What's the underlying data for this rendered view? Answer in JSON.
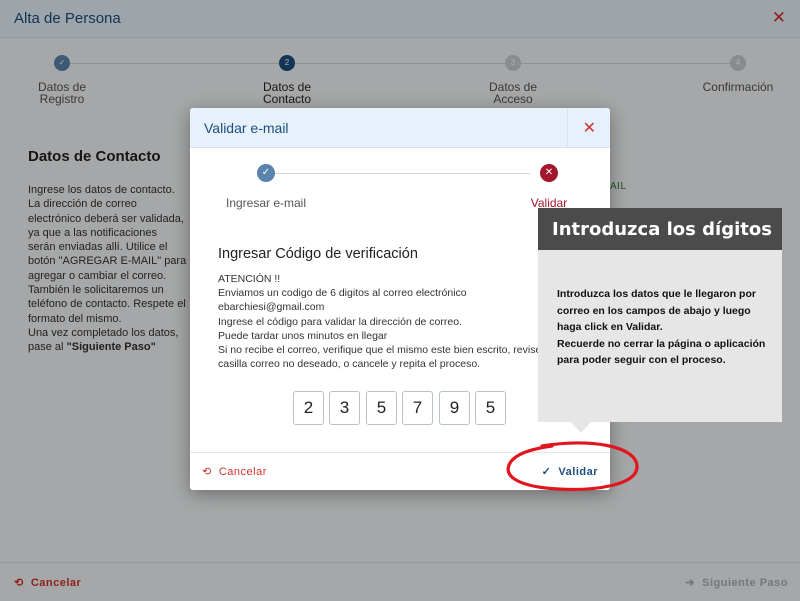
{
  "window": {
    "title": "Alta de Persona",
    "close_icon": "✕"
  },
  "stepper": {
    "steps": [
      {
        "number": "",
        "label_line1": "Datos de",
        "label_line2": "Registro",
        "state": "done"
      },
      {
        "number": "2",
        "label_line1": "Datos de",
        "label_line2": "Contacto",
        "state": "active"
      },
      {
        "number": "3",
        "label_line1": "Datos de",
        "label_line2": "Acceso",
        "state": "pending"
      },
      {
        "number": "4",
        "label_line1": "Confirmación",
        "label_line2": "",
        "state": "pending"
      }
    ]
  },
  "contact": {
    "heading": "Datos de Contacto",
    "instructions": [
      "Ingrese los datos de contacto.",
      "La dirección de correo",
      "electrónico deberá ser validada,",
      "ya que a las notificaciones",
      "serán enviadas allí. Utilice el",
      "botón \"AGREGAR E-MAIL\" para",
      "agregar o cambiar el correo.",
      "También le solicitaremos un",
      "teléfono de contacto. Respete el",
      "formato del mismo.",
      "Una vez completado los datos,"
    ],
    "instructions_last_prefix": "pase al ",
    "instructions_last_bold": "\"Siguiente Paso\"",
    "email_hint": "AIL"
  },
  "footer": {
    "cancel_label": "Cancelar",
    "next_label": "Siguiente Paso"
  },
  "modal": {
    "title": "Validar e-mail",
    "steps": [
      {
        "label": "Ingresar e-mail",
        "state": "done"
      },
      {
        "label": "Validar",
        "state": "error"
      }
    ],
    "code_title": "Ingresar Código de verificación",
    "message_lines": [
      "ATENCIÓN !!",
      "Enviamos un codigo de 6 digitos al correo electrónico",
      "ebarchiesi@gmail.com",
      "Ingrese el código para validar la dirección de correo.",
      "Puede tardar unos minutos en llegar",
      "Si no recibe el correo, verifique que el mismo este bien escrito, revise la",
      "casilla correo no deseado, o cancele y repita el proceso."
    ],
    "digits": [
      "2",
      "3",
      "5",
      "7",
      "9",
      "5"
    ],
    "cancel_label": "Cancelar",
    "validate_label": "Validar"
  },
  "tooltip": {
    "heading": "Introduzca  los dígitos",
    "lines": [
      "Introduzca los datos que le llegaron por",
      "correo en los campos de abajo y luego",
      "haga click en Validar.",
      "Recuerde no cerrar la página o aplicación",
      "para poder seguir con el proceso."
    ]
  },
  "colors": {
    "accent_blue": "#1d4f7e",
    "step_done": "#5b84ad",
    "step_active": "#1d4f7e",
    "step_pending": "#c9cfd5",
    "danger": "#d0332b",
    "error_step": "#a3172c",
    "annotation_red": "#e0151e"
  }
}
